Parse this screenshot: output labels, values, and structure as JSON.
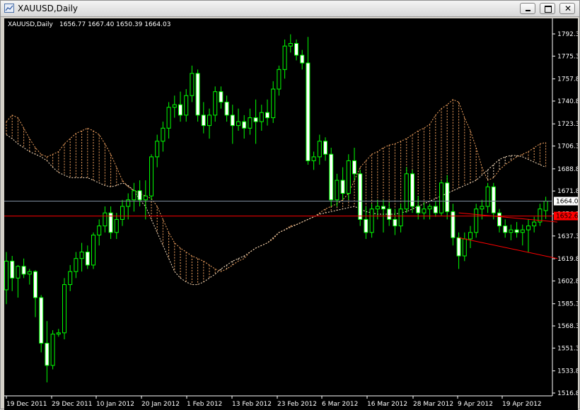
{
  "window": {
    "title": "XAUUSD,Daily"
  },
  "chart_info": {
    "symbol": "XAUUSD,Daily",
    "ohlc": "1656.77 1667.40 1650.39 1664.03"
  },
  "colors": {
    "background": "#000000",
    "candle": "#00ff00",
    "bull_body": "#000000",
    "bear_body": "#ffffff",
    "bid_line": "#8090a0",
    "horizontal_line": "#ff0000",
    "trend_lines": "#ff0000",
    "cloud_bull": "#f4a460",
    "cloud_bear": "#ffe4c4"
  },
  "price_labels": {
    "current": "1664.03",
    "horizontal_line": "1652.60"
  },
  "chart_data": {
    "type": "candlestick",
    "title": "XAUUSD,Daily",
    "ylim": [
      1510,
      1800
    ],
    "y_ticks": [
      "1792.30",
      "1775.30",
      "1757.80",
      "1740.80",
      "1723.30",
      "1706.30",
      "1688.80",
      "1671.80",
      "1654.30",
      "1637.30",
      "1619.80",
      "1602.80",
      "1585.30",
      "1568.30",
      "1551.30",
      "1533.80",
      "1516.80"
    ],
    "x_ticks": [
      "19 Dec 2011",
      "29 Dec 2011",
      "10 Jan 2012",
      "20 Jan 2012",
      "1 Feb 2012",
      "13 Feb 2012",
      "23 Feb 2012",
      "6 Mar 2012",
      "16 Mar 2012",
      "28 Mar 2012",
      "9 Apr 2012",
      "19 Apr 2012"
    ],
    "candles": [
      [
        1596,
        1625,
        1585,
        1618
      ],
      [
        1618,
        1622,
        1595,
        1605
      ],
      [
        1605,
        1615,
        1590,
        1614
      ],
      [
        1614,
        1620,
        1605,
        1608
      ],
      [
        1608,
        1612,
        1600,
        1610
      ],
      [
        1610,
        1611,
        1575,
        1590
      ],
      [
        1590,
        1592,
        1548,
        1555
      ],
      [
        1555,
        1572,
        1525,
        1538
      ],
      [
        1538,
        1565,
        1535,
        1562
      ],
      [
        1562,
        1566,
        1560,
        1563
      ],
      [
        1563,
        1605,
        1558,
        1600
      ],
      [
        1600,
        1615,
        1595,
        1610
      ],
      [
        1610,
        1625,
        1605,
        1620
      ],
      [
        1620,
        1632,
        1610,
        1625
      ],
      [
        1625,
        1630,
        1612,
        1615
      ],
      [
        1615,
        1640,
        1612,
        1638
      ],
      [
        1638,
        1650,
        1630,
        1645
      ],
      [
        1645,
        1660,
        1640,
        1655
      ],
      [
        1655,
        1660,
        1635,
        1640
      ],
      [
        1640,
        1655,
        1635,
        1650
      ],
      [
        1650,
        1665,
        1645,
        1660
      ],
      [
        1660,
        1670,
        1650,
        1665
      ],
      [
        1665,
        1678,
        1656,
        1672
      ],
      [
        1672,
        1680,
        1660,
        1665
      ],
      [
        1665,
        1680,
        1650,
        1668
      ],
      [
        1668,
        1700,
        1665,
        1698
      ],
      [
        1698,
        1715,
        1690,
        1710
      ],
      [
        1710,
        1725,
        1702,
        1720
      ],
      [
        1720,
        1740,
        1712,
        1736
      ],
      [
        1736,
        1745,
        1728,
        1738
      ],
      [
        1738,
        1748,
        1725,
        1730
      ],
      [
        1730,
        1750,
        1725,
        1745
      ],
      [
        1745,
        1768,
        1740,
        1762
      ],
      [
        1762,
        1765,
        1725,
        1730
      ],
      [
        1730,
        1740,
        1716,
        1722
      ],
      [
        1722,
        1735,
        1712,
        1730
      ],
      [
        1730,
        1752,
        1725,
        1748
      ],
      [
        1748,
        1752,
        1735,
        1740
      ],
      [
        1740,
        1745,
        1725,
        1730
      ],
      [
        1730,
        1738,
        1708,
        1722
      ],
      [
        1722,
        1735,
        1718,
        1725
      ],
      [
        1725,
        1730,
        1712,
        1720
      ],
      [
        1720,
        1735,
        1715,
        1728
      ],
      [
        1728,
        1742,
        1708,
        1725
      ],
      [
        1725,
        1738,
        1718,
        1732
      ],
      [
        1732,
        1742,
        1722,
        1728
      ],
      [
        1728,
        1756,
        1724,
        1750
      ],
      [
        1750,
        1768,
        1745,
        1765
      ],
      [
        1765,
        1788,
        1758,
        1783
      ],
      [
        1783,
        1792,
        1778,
        1785
      ],
      [
        1785,
        1788,
        1772,
        1776
      ],
      [
        1776,
        1780,
        1765,
        1770
      ],
      [
        1770,
        1790,
        1692,
        1695
      ],
      [
        1695,
        1702,
        1688,
        1698
      ],
      [
        1698,
        1715,
        1692,
        1710
      ],
      [
        1710,
        1713,
        1695,
        1700
      ],
      [
        1700,
        1705,
        1660,
        1665
      ],
      [
        1665,
        1685,
        1660,
        1680
      ],
      [
        1680,
        1690,
        1665,
        1670
      ],
      [
        1670,
        1700,
        1665,
        1695
      ],
      [
        1695,
        1705,
        1680,
        1685
      ],
      [
        1685,
        1688,
        1645,
        1650
      ],
      [
        1650,
        1660,
        1635,
        1640
      ],
      [
        1640,
        1662,
        1636,
        1658
      ],
      [
        1658,
        1665,
        1650,
        1660
      ],
      [
        1660,
        1665,
        1640,
        1658
      ],
      [
        1658,
        1663,
        1645,
        1650
      ],
      [
        1650,
        1658,
        1638,
        1645
      ],
      [
        1645,
        1662,
        1640,
        1658
      ],
      [
        1658,
        1690,
        1655,
        1685
      ],
      [
        1685,
        1688,
        1655,
        1660
      ],
      [
        1660,
        1668,
        1650,
        1655
      ],
      [
        1655,
        1663,
        1650,
        1658
      ],
      [
        1658,
        1662,
        1650,
        1660
      ],
      [
        1660,
        1664,
        1652,
        1655
      ],
      [
        1655,
        1680,
        1653,
        1678
      ],
      [
        1678,
        1684,
        1650,
        1656
      ],
      [
        1656,
        1662,
        1630,
        1636
      ],
      [
        1636,
        1640,
        1612,
        1622
      ],
      [
        1622,
        1640,
        1618,
        1635
      ],
      [
        1635,
        1645,
        1628,
        1640
      ],
      [
        1640,
        1662,
        1636,
        1658
      ],
      [
        1658,
        1665,
        1650,
        1660
      ],
      [
        1660,
        1678,
        1655,
        1675
      ],
      [
        1675,
        1678,
        1650,
        1655
      ],
      [
        1655,
        1658,
        1640,
        1645
      ],
      [
        1645,
        1650,
        1636,
        1640
      ],
      [
        1640,
        1646,
        1634,
        1642
      ],
      [
        1642,
        1648,
        1636,
        1640
      ],
      [
        1640,
        1646,
        1630,
        1642
      ],
      [
        1642,
        1650,
        1625,
        1645
      ],
      [
        1645,
        1652,
        1640,
        1648
      ],
      [
        1648,
        1662,
        1645,
        1658
      ],
      [
        1656.77,
        1667.4,
        1650.39,
        1664.03
      ]
    ],
    "series": [
      {
        "kind": "cloud_span_a",
        "values": [
          1725,
          1730,
          1728,
          1720,
          1712,
          1705,
          1700,
          1698,
          1700,
          1702,
          1708,
          1712,
          1716,
          1718,
          1720,
          1718,
          1715,
          1708,
          1700,
          1690,
          1680,
          1675,
          1672,
          1670,
          1668,
          1666,
          1660,
          1650,
          1640,
          1632,
          1628,
          1625,
          1622,
          1620,
          1618,
          1615,
          1612,
          1610,
          1612,
          1615,
          1618,
          1620,
          1625,
          1628,
          1630,
          1632,
          1635,
          1640,
          1642,
          1645,
          1646,
          1648,
          1650,
          1652,
          1655,
          1658,
          1660,
          1662,
          1665,
          1670,
          1680,
          1690,
          1695,
          1700,
          1702,
          1705,
          1707,
          1708,
          1710,
          1712,
          1715,
          1718,
          1720,
          1723,
          1730,
          1735,
          1738,
          1742,
          1740,
          1728,
          1718,
          1705,
          1690,
          1680,
          1682,
          1688,
          1692,
          1695,
          1698,
          1700,
          1702,
          1705,
          1708,
          1709
        ]
      },
      {
        "kind": "cloud_span_b",
        "values": [
          1715,
          1712,
          1708,
          1705,
          1702,
          1700,
          1698,
          1695,
          1690,
          1686,
          1684,
          1682,
          1682,
          1682,
          1682,
          1680,
          1678,
          1676,
          1675,
          1676,
          1678,
          1676,
          1672,
          1665,
          1660,
          1650,
          1640,
          1630,
          1620,
          1610,
          1605,
          1602,
          1600,
          1600,
          1602,
          1605,
          1608,
          1612,
          1615,
          1618,
          1620,
          1622,
          1625,
          1628,
          1630,
          1632,
          1636,
          1640,
          1642,
          1644,
          1646,
          1648,
          1650,
          1652,
          1654,
          1655,
          1656,
          1657,
          1658,
          1659,
          1660,
          1658,
          1656,
          1655,
          1654,
          1654,
          1654,
          1654,
          1655,
          1656,
          1658,
          1660,
          1662,
          1664,
          1666,
          1668,
          1670,
          1672,
          1674,
          1676,
          1678,
          1680,
          1684,
          1688,
          1692,
          1696,
          1698,
          1699,
          1699,
          1698,
          1696,
          1694,
          1692,
          1690
        ]
      }
    ],
    "trend_lines": [
      {
        "from": [
          1652,
          1655
        ],
        "to": [
          1669,
          1648
        ]
      },
      {
        "from": [
          1652,
          1636
        ],
        "to": [
          1669,
          1620
        ]
      }
    ],
    "horizontal_line": 1652.6,
    "bid_line": 1664.03
  }
}
